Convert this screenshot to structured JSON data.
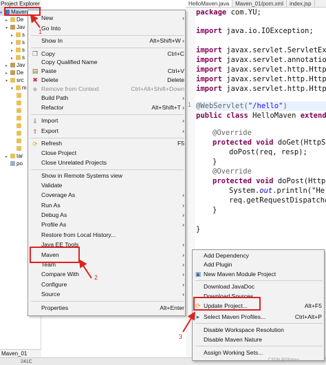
{
  "explorer": {
    "title": "Project Explorer",
    "rows": [
      {
        "text": "Maven_01",
        "icon": "project-icon"
      },
      {
        "text": "De",
        "icon": "folder-icon"
      },
      {
        "text": "Jav",
        "icon": "library-icon"
      },
      {
        "text": "s",
        "icon": "folder-icon"
      },
      {
        "text": "s",
        "icon": "folder-icon"
      },
      {
        "text": "s",
        "icon": "folder-icon"
      },
      {
        "text": "s",
        "icon": "folder-icon"
      },
      {
        "text": "Jav",
        "icon": "library-icon"
      },
      {
        "text": "De",
        "icon": "library-icon"
      },
      {
        "text": "src",
        "icon": "folder-icon"
      },
      {
        "text": "m",
        "icon": "folder-icon"
      },
      {
        "text": "",
        "icon": "folder-icon"
      },
      {
        "text": "",
        "icon": "folder-icon"
      },
      {
        "text": "",
        "icon": "folder-icon"
      },
      {
        "text": "",
        "icon": "folder-icon"
      },
      {
        "text": "",
        "icon": "folder-icon"
      },
      {
        "text": "",
        "icon": "folder-icon"
      },
      {
        "text": "",
        "icon": "folder-icon"
      },
      {
        "text": "",
        "icon": "folder-icon"
      },
      {
        "text": "",
        "icon": "folder-icon"
      },
      {
        "text": "tar",
        "icon": "folder-icon"
      },
      {
        "text": "po",
        "icon": "file-icon"
      }
    ],
    "bottom_tab": "Maven_01",
    "status_text": "241C"
  },
  "editor": {
    "tabs": [
      "HelloMaven.java",
      "Maven_01/pom.xml",
      "index.jsp"
    ],
    "gutter": [
      "1",
      "",
      "",
      "",
      "",
      "",
      "",
      "",
      "",
      "",
      "",
      ""
    ],
    "code": {
      "l1_kw": "package",
      "l1_rest": " com.YU;",
      "l3_kw": "import",
      "l3_rest": " java.io.IOException;",
      "l5_kw": "import",
      "l5_rest": " javax.servlet.ServletExc",
      "l6_kw": "import",
      "l6_rest": " javax.servlet.annotatio",
      "l7_kw": "import",
      "l7_rest": " javax.servlet.http.Http",
      "l8_kw": "import",
      "l8_rest": " javax.servlet.http.Http",
      "l9_kw": "import",
      "l9_rest": " javax.servlet.http.Http",
      "l11_ann": "@WebServlet(",
      "l11_str": "\"/hello\"",
      "l11_end": ")",
      "l12_kw": "public class",
      "l12_rest": " HelloMaven ",
      "l12_kw2": "extend",
      "l14_ann": "@Override",
      "l15_kw": "protected void",
      "l15_rest": " doGet(HttpS",
      "l16_rest": "doPost(req, resp);",
      "l17_rest": "}",
      "l18_ann": "@Override",
      "l19_kw": "protected void",
      "l19_rest": " doPost(Http",
      "l20_pre": "System.",
      "l20_fld": "out",
      "l20_rest": ".println(\"He",
      "l21_rest": "req.getRequestDispatche",
      "l22_rest": "}",
      "l24_rest": "}"
    }
  },
  "context_menu": {
    "new": "New",
    "go_into": "Go Into",
    "show_in": "Show In",
    "show_in_acc": "Alt+Shift+W",
    "copy": "Copy",
    "copy_acc": "Ctrl+C",
    "copy_qualified": "Copy Qualified Name",
    "paste": "Paste",
    "paste_acc": "Ctrl+V",
    "delete": "Delete",
    "delete_acc": "Delete",
    "remove_context": "Remove from Context",
    "remove_context_acc": "Ctrl+Alt+Shift+Down",
    "build_path": "Build Path",
    "refactor": "Refactor",
    "refactor_acc": "Alt+Shift+T",
    "import": "Import",
    "export": "Export",
    "refresh": "Refresh",
    "refresh_acc": "F5",
    "close_project": "Close Project",
    "close_unrelated": "Close Unrelated Projects",
    "show_remote": "Show in Remote Systems view",
    "validate": "Validate",
    "coverage_as": "Coverage As",
    "run_as": "Run As",
    "debug_as": "Debug As",
    "profile_as": "Profile As",
    "restore_history": "Restore from Local History...",
    "java_ee_tools": "Java EE Tools",
    "maven": "Maven",
    "team": "Team",
    "compare_with": "Compare With",
    "configure": "Configure",
    "source": "Source",
    "properties": "Properties",
    "properties_acc": "Alt+Enter"
  },
  "maven_submenu": {
    "add_dependency": "Add Dependency",
    "add_plugin": "Add Plugin",
    "new_module": "New Maven Module Project",
    "download_javadoc": "Download JavaDoc",
    "download_sources": "Download Sources",
    "update_project": "Update Project...",
    "update_project_acc": "Alt+F5",
    "select_profiles": "Select Maven Profiles...",
    "select_profiles_acc": "Ctrl+Alt+P",
    "disable_resolution": "Disable Workspace Resolution",
    "disable_nature": "Disable Maven Nature",
    "assign_sets": "Assign Working Sets..."
  },
  "annotations": {
    "step1": "1",
    "step2": "2",
    "step3": "3",
    "watermark": "CSDN @Shanxu"
  },
  "colors": {
    "annotation_red": "#e02020",
    "menu_bg": "#f2f2f2",
    "keyword": "#7f0055",
    "string": "#2a00ff"
  }
}
